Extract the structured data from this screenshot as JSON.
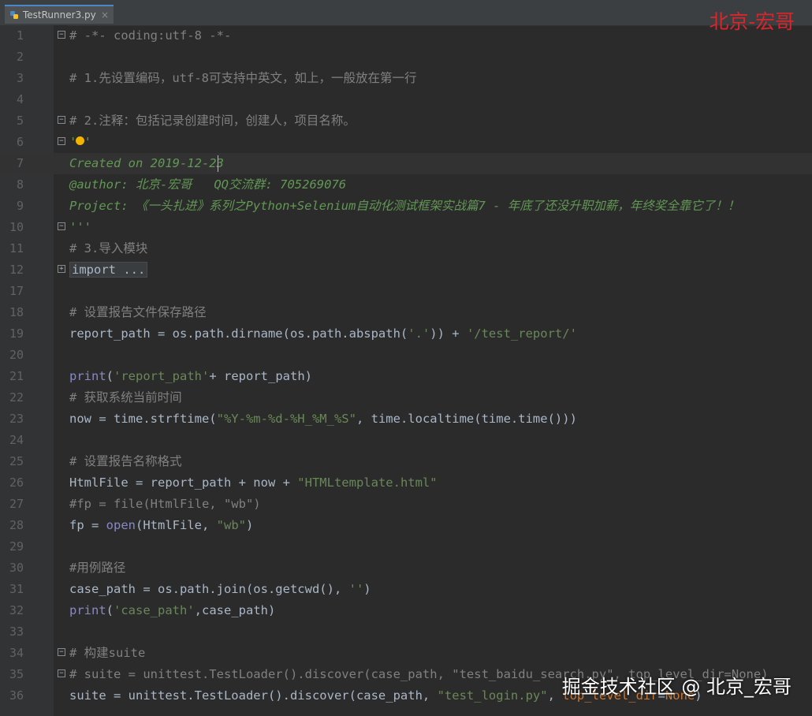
{
  "tab": {
    "filename": "TestRunner3.py",
    "close": "×"
  },
  "watermark_top": "北京-宏哥",
  "watermark_bottom": "掘金技术社区 @ 北京_宏哥",
  "accent_colors": {
    "comment": "#808080",
    "string": "#6a8759",
    "docstring": "#629755",
    "builtin": "#8888c6",
    "keyword": "#cc7832",
    "watermark": "#d8262c"
  },
  "lines": [
    {
      "num": "1",
      "fold": "−",
      "parts": [
        {
          "t": "# -*- coding:utf-8 -*-",
          "k": "c"
        }
      ]
    },
    {
      "num": "2",
      "parts": []
    },
    {
      "num": "3",
      "parts": [
        {
          "t": "# 1.先设置编码，utf-8可支持中英文，如上，一般放在第一行",
          "k": "c"
        }
      ]
    },
    {
      "num": "4",
      "parts": []
    },
    {
      "num": "5",
      "fold": "−",
      "parts": [
        {
          "t": "# 2.注释：包括记录创建时间，创建人，项目名称。",
          "k": "c"
        }
      ]
    },
    {
      "num": "6",
      "fold": "−",
      "bulb": true,
      "parts": [
        {
          "t": "'''",
          "k": "d"
        }
      ]
    },
    {
      "num": "7",
      "current": true,
      "parts": [
        {
          "t": "Created on 2019-12-23",
          "k": "d"
        }
      ]
    },
    {
      "num": "8",
      "parts": [
        {
          "t": "@author: 北京-宏哥   QQ交流群: 705269076",
          "k": "d"
        }
      ]
    },
    {
      "num": "9",
      "parts": [
        {
          "t": "Project: 《一头扎进》系列之Python+Selenium自动化测试框架实战篇7 - 年底了还没升职加薪，年终奖全靠它了！！",
          "k": "d"
        }
      ]
    },
    {
      "num": "10",
      "fold": "−",
      "parts": [
        {
          "t": "'''",
          "k": "d"
        }
      ]
    },
    {
      "num": "11",
      "parts": [
        {
          "t": "# 3.导入模块",
          "k": "c"
        }
      ]
    },
    {
      "num": "12",
      "fold": "+",
      "parts": [
        {
          "t": "import ...",
          "k": "imp"
        }
      ]
    },
    {
      "num": "17",
      "parts": []
    },
    {
      "num": "18",
      "parts": [
        {
          "t": "# 设置报告文件保存路径",
          "k": "c"
        }
      ]
    },
    {
      "num": "19",
      "parts": [
        {
          "t": "report_path = os.path.dirname(os.path.abspath(",
          "k": ""
        },
        {
          "t": "'.'",
          "k": "s"
        },
        {
          "t": ")) + ",
          "k": ""
        },
        {
          "t": "'/test_report/'",
          "k": "s"
        }
      ]
    },
    {
      "num": "20",
      "parts": []
    },
    {
      "num": "21",
      "parts": [
        {
          "t": "print",
          "k": "f"
        },
        {
          "t": "(",
          "k": ""
        },
        {
          "t": "'report_path'",
          "k": "s"
        },
        {
          "t": "+ report_path)",
          "k": ""
        }
      ]
    },
    {
      "num": "22",
      "parts": [
        {
          "t": "# 获取系统当前时间",
          "k": "c"
        }
      ]
    },
    {
      "num": "23",
      "parts": [
        {
          "t": "now = time.strftime(",
          "k": ""
        },
        {
          "t": "\"%Y-%m-%d-%H_%M_%S\"",
          "k": "s"
        },
        {
          "t": ", time.localtime(time.time()))",
          "k": ""
        }
      ]
    },
    {
      "num": "24",
      "parts": []
    },
    {
      "num": "25",
      "parts": [
        {
          "t": "# 设置报告名称格式",
          "k": "c"
        }
      ]
    },
    {
      "num": "26",
      "parts": [
        {
          "t": "HtmlFile = report_path + now + ",
          "k": ""
        },
        {
          "t": "\"HTMLtemplate.html\"",
          "k": "s"
        }
      ]
    },
    {
      "num": "27",
      "parts": [
        {
          "t": "#fp = file(HtmlFile, \"wb\")",
          "k": "c"
        }
      ]
    },
    {
      "num": "28",
      "parts": [
        {
          "t": "fp = ",
          "k": ""
        },
        {
          "t": "open",
          "k": "f"
        },
        {
          "t": "(HtmlFile, ",
          "k": ""
        },
        {
          "t": "\"wb\"",
          "k": "s"
        },
        {
          "t": ")",
          "k": ""
        }
      ]
    },
    {
      "num": "29",
      "parts": []
    },
    {
      "num": "30",
      "parts": [
        {
          "t": "#用例路径",
          "k": "c"
        }
      ]
    },
    {
      "num": "31",
      "parts": [
        {
          "t": "case_path = os.path.join(os.getcwd(), ",
          "k": ""
        },
        {
          "t": "''",
          "k": "s"
        },
        {
          "t": ")",
          "k": ""
        }
      ]
    },
    {
      "num": "32",
      "parts": [
        {
          "t": "print",
          "k": "f"
        },
        {
          "t": "(",
          "k": ""
        },
        {
          "t": "'case_path'",
          "k": "s"
        },
        {
          "t": ",case_path)",
          "k": ""
        }
      ]
    },
    {
      "num": "33",
      "parts": []
    },
    {
      "num": "34",
      "fold": "−",
      "parts": [
        {
          "t": "# 构建suite",
          "k": "c"
        }
      ]
    },
    {
      "num": "35",
      "fold": "−",
      "parts": [
        {
          "t": "# suite = unittest.TestLoader().discover(case_path, \"test_baidu_search.py\", top_level_dir=None)",
          "k": "c"
        }
      ]
    },
    {
      "num": "36",
      "parts": [
        {
          "t": "suite = unittest.TestLoader().discover(case_path, ",
          "k": ""
        },
        {
          "t": "\"test_login.py\"",
          "k": "s"
        },
        {
          "t": ", ",
          "k": ""
        },
        {
          "t": "top_level_dir",
          "k": "n"
        },
        {
          "t": "=",
          "k": ""
        },
        {
          "t": "None",
          "k": "n"
        },
        {
          "t": ")",
          "k": ""
        }
      ]
    }
  ]
}
